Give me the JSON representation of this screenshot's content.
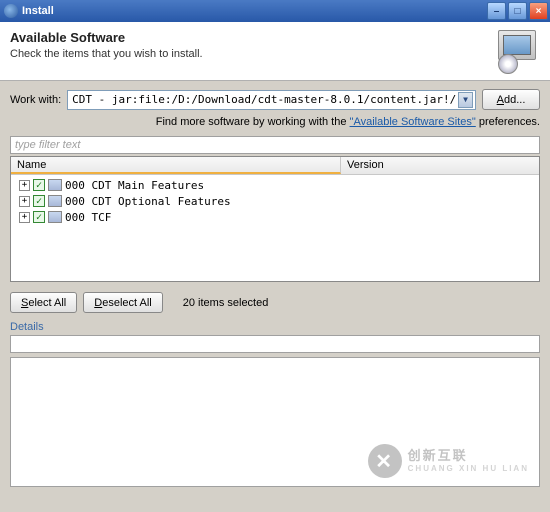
{
  "window": {
    "title": "Install"
  },
  "banner": {
    "title": "Available Software",
    "subtitle": "Check the items that you wish to install."
  },
  "work_with": {
    "label": "Work with:",
    "value": "CDT - jar:file:/D:/Download/cdt-master-8.0.1/content.jar!/",
    "add_btn": "Add..."
  },
  "hint": {
    "prefix": "Find more software by working with the ",
    "link": "\"Available Software Sites\"",
    "suffix": " preferences."
  },
  "filter": {
    "placeholder": "type filter text"
  },
  "columns": {
    "name": "Name",
    "version": "Version"
  },
  "tree": [
    {
      "label": "000 CDT Main Features",
      "checked": true,
      "expandable": true
    },
    {
      "label": "000 CDT Optional Features",
      "checked": true,
      "expandable": true
    },
    {
      "label": "000 TCF",
      "checked": true,
      "expandable": true
    }
  ],
  "selection": {
    "select_all": "Select All",
    "deselect_all": "Deselect All",
    "status": "20 items selected"
  },
  "details": {
    "label": "Details"
  },
  "watermark": {
    "main": "创新互联",
    "sub": "CHUANG XIN HU LIAN"
  }
}
